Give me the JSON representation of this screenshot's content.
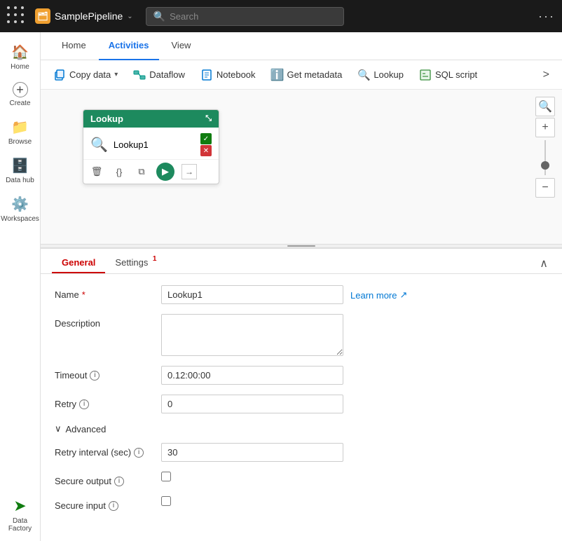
{
  "topbar": {
    "app_grid_icon": "⊞",
    "pipeline_name": "SamplePipeline",
    "pipeline_icon_text": "P",
    "chevron": "⌄",
    "search_placeholder": "Search",
    "more_icon": "···"
  },
  "sidebar": {
    "items": [
      {
        "id": "home",
        "label": "Home",
        "icon": "⌂"
      },
      {
        "id": "create",
        "label": "Create",
        "icon": "+"
      },
      {
        "id": "browse",
        "label": "Browse",
        "icon": "📁"
      },
      {
        "id": "datahub",
        "label": "Data hub",
        "icon": "⊞"
      },
      {
        "id": "workspaces",
        "label": "Workspaces",
        "icon": "☰"
      }
    ],
    "bottom_item": {
      "id": "datafactory",
      "label": "Data Factory",
      "icon": "🏭"
    }
  },
  "tabs": {
    "items": [
      {
        "id": "home",
        "label": "Home"
      },
      {
        "id": "activities",
        "label": "Activities"
      },
      {
        "id": "view",
        "label": "View"
      }
    ],
    "active": "activities"
  },
  "toolbar": {
    "buttons": [
      {
        "id": "copy-data",
        "label": "Copy data",
        "has_dropdown": true,
        "icon": "📋"
      },
      {
        "id": "dataflow",
        "label": "Dataflow",
        "icon": "⊞"
      },
      {
        "id": "notebook",
        "label": "Notebook",
        "icon": "📓"
      },
      {
        "id": "get-metadata",
        "label": "Get metadata",
        "icon": "ℹ"
      },
      {
        "id": "lookup",
        "label": "Lookup",
        "icon": "🔍"
      },
      {
        "id": "sql-script",
        "label": "SQL script",
        "icon": "📄"
      }
    ],
    "more_icon": ">"
  },
  "canvas": {
    "node": {
      "header": "Lookup",
      "name": "Lookup1",
      "search_icon": "🔍",
      "status_check": "✓",
      "status_x": "✕"
    }
  },
  "bottom_panel": {
    "tabs": [
      {
        "id": "general",
        "label": "General",
        "badge": null
      },
      {
        "id": "settings",
        "label": "Settings",
        "badge": "1"
      }
    ],
    "active": "general",
    "form": {
      "name_label": "Name",
      "name_required": "*",
      "name_value": "Lookup1",
      "learn_more_label": "Learn more",
      "learn_more_icon": "↗",
      "description_label": "Description",
      "description_value": "",
      "timeout_label": "Timeout",
      "timeout_info": "i",
      "timeout_value": "0.12:00:00",
      "retry_label": "Retry",
      "retry_info": "i",
      "retry_value": "0",
      "advanced_label": "Advanced",
      "retry_interval_label": "Retry interval (sec)",
      "retry_interval_info": "i",
      "retry_interval_value": "30",
      "secure_output_label": "Secure output",
      "secure_output_info": "i",
      "secure_input_label": "Secure input",
      "secure_input_info": "i"
    }
  }
}
